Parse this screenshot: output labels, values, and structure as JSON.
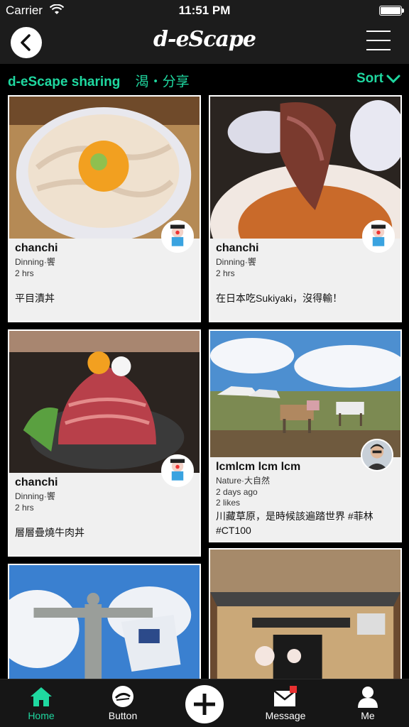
{
  "status_bar": {
    "carrier": "Carrier",
    "time": "11:51 PM"
  },
  "nav": {
    "logo": "d-eScape"
  },
  "subheader": {
    "title": "d-eScape sharing",
    "title_cjk": "渴・分享",
    "sort_label": "Sort"
  },
  "colors": {
    "accent": "#1fd8a0",
    "bar_bg": "#1c1c1c"
  },
  "posts": [
    {
      "author": "chanchi",
      "category": "Dinning·饗",
      "age": "2 hrs",
      "likes": "",
      "caption": "平目漬丼",
      "photo": "fish-rice-bowl",
      "avatar": "clown-avatar"
    },
    {
      "author": "chanchi",
      "category": "Dinning·饗",
      "age": "2 hrs",
      "likes": "",
      "caption": "在日本吃Sukiyaki，沒得輸！",
      "photo": "sukiyaki-beef",
      "avatar": "clown-avatar"
    },
    {
      "author": "chanchi",
      "category": "Dinning·饗",
      "age": "2 hrs",
      "likes": "",
      "caption": "層層疊燒牛肉丼",
      "photo": "roast-beef-bowl",
      "avatar": "clown-avatar"
    },
    {
      "author": "lcmlcm lcm lcm",
      "category": "Nature·大自然",
      "age": "2 days ago",
      "likes": "2 likes",
      "caption": "川藏草原，是時候該遍踏世界 #菲林 #CT100",
      "photo": "grassland-horses",
      "avatar": "man-avatar"
    },
    {
      "author": "",
      "category": "",
      "age": "",
      "likes": "",
      "caption": "",
      "photo": "christ-redeemer",
      "avatar": ""
    },
    {
      "author": "",
      "category": "",
      "age": "",
      "likes": "",
      "caption": "",
      "photo": "kyoto-house",
      "avatar": ""
    }
  ],
  "tabs": [
    {
      "label": "Home",
      "icon": "home-icon"
    },
    {
      "label": "Button",
      "icon": "escape-logo-icon"
    },
    {
      "label": "",
      "icon": "plus-icon"
    },
    {
      "label": "Message",
      "icon": "mail-icon"
    },
    {
      "label": "Me",
      "icon": "person-icon"
    }
  ]
}
